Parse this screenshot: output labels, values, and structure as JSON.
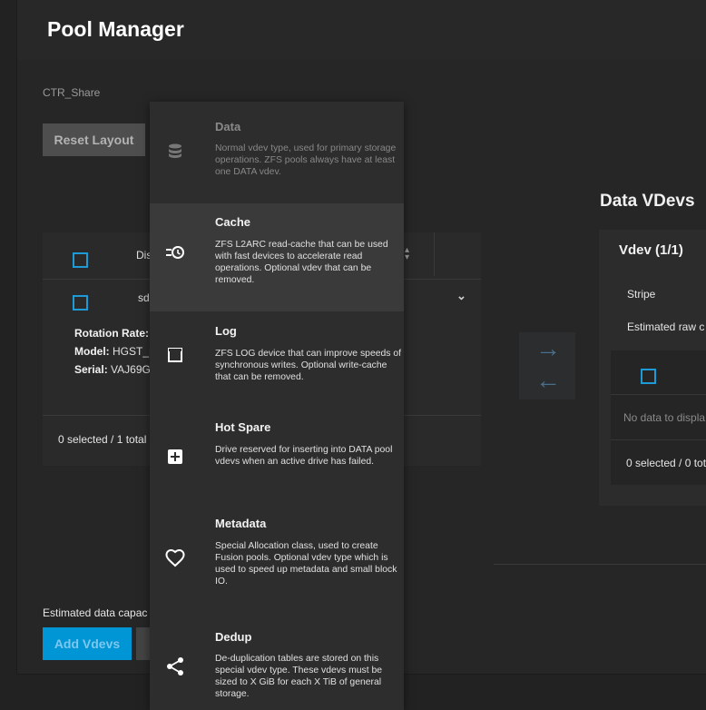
{
  "page_title": "Pool Manager",
  "pool_name": "CTR_Share",
  "buttons": {
    "reset_layout": "Reset Layout",
    "add_vdevs": "Add Vdevs"
  },
  "available_disks": {
    "header_label": "Dis",
    "rows": [
      {
        "name": "sd",
        "details": [
          {
            "label": "Rotation Rate:",
            "value": ""
          },
          {
            "label": "Model:",
            "value": "HGST_H"
          },
          {
            "label": "Serial:",
            "value": "VAJ69G"
          }
        ]
      }
    ],
    "footer": "0 selected / 1 total"
  },
  "estimated_capacity": "Estimated data capac",
  "data_vdevs": {
    "title": "Data VDevs",
    "vdev_title": "Vdev (1/1)",
    "layout": "Stripe",
    "raw_capacity": "Estimated raw c",
    "no_data": "No data to displa",
    "footer": "0 selected / 0 tot"
  },
  "menu": {
    "items": [
      {
        "title": "Data",
        "icon": "database-icon",
        "disabled": true,
        "active": false,
        "description": "Normal vdev type, used for primary storage operations. ZFS pools always have at least one DATA vdev."
      },
      {
        "title": "Cache",
        "icon": "cache-icon",
        "disabled": false,
        "active": true,
        "description": "ZFS L2ARC read-cache that can be used with fast devices to accelerate read operations. Optional vdev that can be removed."
      },
      {
        "title": "Log",
        "icon": "log-icon",
        "disabled": false,
        "active": false,
        "description": "ZFS LOG device that can improve speeds of synchronous writes. Optional write-cache that can be removed."
      },
      {
        "title": "Hot Spare",
        "icon": "add-box-icon",
        "disabled": false,
        "active": false,
        "description": "Drive reserved for inserting into DATA pool vdevs when an active drive has failed."
      },
      {
        "title": "Metadata",
        "icon": "heart-icon",
        "disabled": false,
        "active": false,
        "description": "Special Allocation class, used to create Fusion pools. Optional vdev type which is used to speed up metadata and small block IO."
      },
      {
        "title": "Dedup",
        "icon": "share-icon",
        "disabled": false,
        "active": false,
        "description": "De-duplication tables are stored on this special vdev type. These vdevs must be sized to X GiB for each X TiB of general storage."
      }
    ]
  },
  "colors": {
    "accent": "#0095d5",
    "checkbox": "#1e9bd7",
    "background": "#222222"
  }
}
